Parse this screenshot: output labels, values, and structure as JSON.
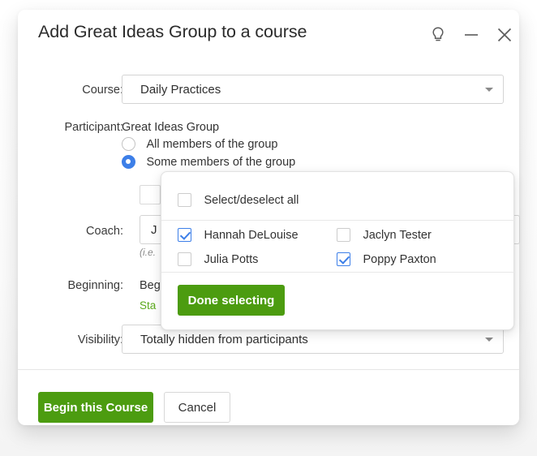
{
  "window": {
    "title": "Add Great Ideas Group to a course",
    "controls": [
      {
        "name": "help-lightbulb-icon",
        "label": "Help"
      },
      {
        "name": "minimize-icon",
        "label": "Minimize"
      },
      {
        "name": "close-icon",
        "label": "Close"
      }
    ]
  },
  "form": {
    "course": {
      "label": "Course:",
      "value": "Daily Practices"
    },
    "participant": {
      "label": "Participant:",
      "group_name": "Great Ideas Group",
      "options": [
        {
          "label": "All members of the group",
          "selected": false
        },
        {
          "label": "Some members of the group",
          "selected": true
        }
      ]
    },
    "coach": {
      "label": "Coach:",
      "value": "J",
      "hint": "(i.e."
    },
    "beginning": {
      "label": "Beginning:",
      "value": "Beg",
      "link": "Sta"
    },
    "visibility": {
      "label": "Visibility:",
      "value": "Totally hidden from participants"
    }
  },
  "popup": {
    "select_all": {
      "label": "Select/deselect all",
      "checked": false
    },
    "members": [
      {
        "label": "Hannah DeLouise",
        "checked": true
      },
      {
        "label": "Jaclyn Tester",
        "checked": false
      },
      {
        "label": "Julia Potts",
        "checked": false
      },
      {
        "label": "Poppy Paxton",
        "checked": true
      }
    ],
    "done_button": "Done selecting"
  },
  "footer": {
    "primary_button": "Begin this Course",
    "secondary_button": "Cancel"
  },
  "colors": {
    "green": "#4c9c10",
    "blue": "#3d7fe8",
    "link_green": "#5aa81a"
  }
}
